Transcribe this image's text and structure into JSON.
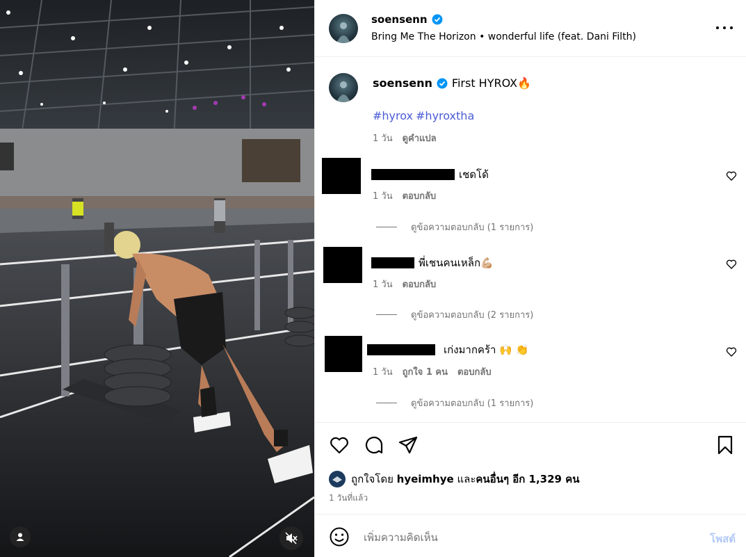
{
  "post": {
    "username": "soensenn",
    "music": "Bring Me The Horizon • wonderful life (feat. Dani Filth)"
  },
  "caption": {
    "username": "soensenn",
    "text": "First HYROX",
    "emoji": "🔥",
    "hashtags": [
      "#hyrox",
      "#hyroxtha"
    ],
    "age": "1 วัน",
    "translate": "ดูคำแปล"
  },
  "comments": [
    {
      "text": "เชดโด้",
      "age": "1 วัน",
      "likes": "",
      "reply": "ตอบกลับ",
      "view_replies": "ดูข้อความตอบกลับ (1 รายการ)"
    },
    {
      "text": "พี่เชนคนเหล็ก",
      "emoji": "💪🏼",
      "age": "1 วัน",
      "likes": "",
      "reply": "ตอบกลับ",
      "view_replies": "ดูข้อความตอบกลับ (2 รายการ)"
    },
    {
      "text": "เก่งมากคร้า",
      "emoji": "🙌 👏",
      "age": "1 วัน",
      "likes": "ถูกใจ 1 คน",
      "reply": "ตอบกลับ",
      "view_replies": "ดูข้อความตอบกลับ (1 รายการ)"
    }
  ],
  "engagement": {
    "liked_by_prefix": "ถูกใจโดย",
    "liked_by_user": "hyeimhye",
    "liked_by_suffix": "และ",
    "others": "คนอื่นๆ อีก 1,329 คน",
    "time_ago": "1 วันที่แล้ว"
  },
  "composer": {
    "placeholder": "เพิ่มความคิดเห็น",
    "post_label": "โพสต์"
  },
  "colors": {
    "verified": "#0095f6",
    "hashtag": "#4a5bd6",
    "post_disabled": "#b2c9f7",
    "muted_text": "#737373"
  },
  "icons": [
    "more-icon",
    "heart-icon",
    "comment-icon",
    "share-icon",
    "bookmark-icon",
    "emoji-icon",
    "user-tag-icon",
    "mute-icon",
    "verified-icon"
  ]
}
